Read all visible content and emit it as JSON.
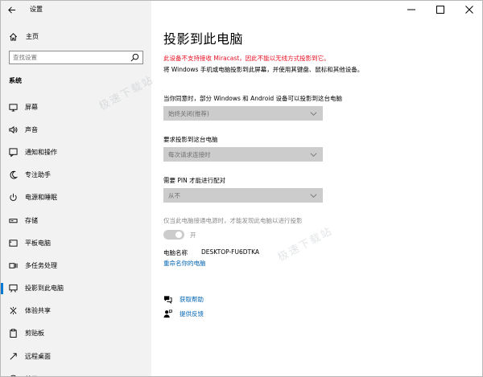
{
  "window": {
    "title": "设置",
    "controls": [
      "minimize",
      "maximize",
      "close"
    ]
  },
  "sidebar": {
    "home_label": "主页",
    "search_placeholder": "查找设置",
    "section": "系统",
    "items": [
      {
        "label": "屏幕",
        "icon": "monitor-icon"
      },
      {
        "label": "声音",
        "icon": "speaker-icon"
      },
      {
        "label": "通知和操作",
        "icon": "notification-icon"
      },
      {
        "label": "专注助手",
        "icon": "moon-icon"
      },
      {
        "label": "电源和睡眠",
        "icon": "power-icon"
      },
      {
        "label": "存储",
        "icon": "storage-icon"
      },
      {
        "label": "平板电脑",
        "icon": "tablet-icon"
      },
      {
        "label": "多任务处理",
        "icon": "multitask-icon"
      },
      {
        "label": "投影到此电脑",
        "icon": "project-icon",
        "active": true
      },
      {
        "label": "体验共享",
        "icon": "share-icon"
      },
      {
        "label": "剪贴板",
        "icon": "clipboard-icon"
      },
      {
        "label": "远程桌面",
        "icon": "remote-icon"
      },
      {
        "label": "关于",
        "icon": "info-icon"
      }
    ]
  },
  "main": {
    "title": "投影到此电脑",
    "warning": "此设备不支持接收 Miracast，因此不能以无线方式投影到它。",
    "description": "将 Windows 手机或电脑投影到此屏幕，并使用其键盘、鼠标和其他设备。",
    "q1": "当你同意时，部分 Windows 和 Android 设备可以投影到这台电脑",
    "dd1": "始终关闭(推荐)",
    "q2": "要求投影到这台电脑",
    "dd2": "每次请求连接时",
    "q3": "需要 PIN 才能进行配对",
    "dd3": "从不",
    "hint": "仅当此电脑接通电源时，才能发现此电脑以进行投影",
    "toggle_label": "开",
    "pc_name_label": "电脑名称",
    "pc_name_value": "DESKTOP-FU6DTKA",
    "rename_link": "重命名你的电脑",
    "help_link": "获取帮助",
    "feedback_link": "提供反馈"
  },
  "watermark": "极速下载站",
  "colors": {
    "accent": "#0078d4",
    "link": "#0063b1",
    "warning": "#e81123",
    "sidebar_bg": "#f2f2f2"
  }
}
